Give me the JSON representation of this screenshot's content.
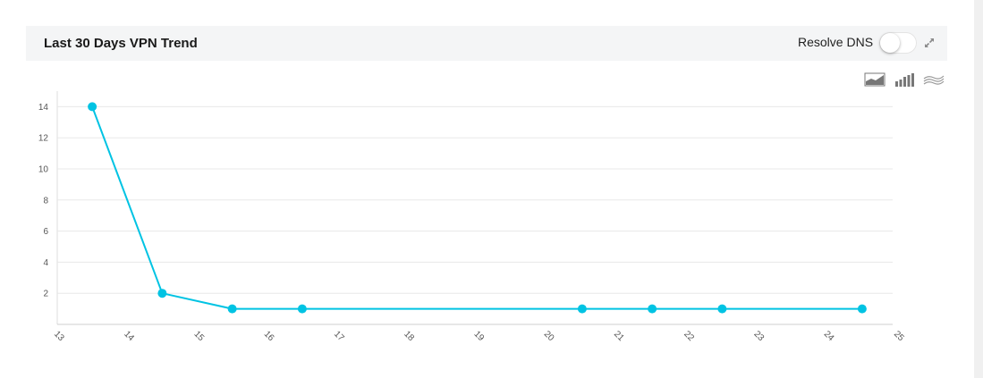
{
  "header": {
    "title": "Last 30 Days VPN Trend",
    "resolve_dns_label": "Resolve DNS",
    "resolve_dns_enabled": false,
    "expand_icon": "expand-icon"
  },
  "toolbar": {
    "icons": [
      "area-chart-icon",
      "bar-chart-icon",
      "line-chart-icon"
    ]
  },
  "colors": {
    "series": "#00c3e3",
    "grid": "#e8e8e8",
    "axis_text": "#555555",
    "header_bg": "#f4f5f6"
  },
  "chart_data": {
    "type": "line",
    "x_ticks": [
      "13",
      "14",
      "15",
      "16",
      "17",
      "18",
      "19",
      "20",
      "21",
      "22",
      "23",
      "24",
      "25"
    ],
    "y_ticks": [
      "2",
      "4",
      "6",
      "8",
      "10",
      "12",
      "14"
    ],
    "xlim": [
      13,
      25
    ],
    "ylim": [
      0,
      15
    ],
    "grid": true,
    "series": [
      {
        "x": [
          13.5,
          14.5,
          15.5,
          16.5,
          20.5,
          21.5,
          22.5,
          24.5
        ],
        "y": [
          14,
          2,
          1,
          1,
          1,
          1,
          1,
          1
        ]
      }
    ]
  }
}
